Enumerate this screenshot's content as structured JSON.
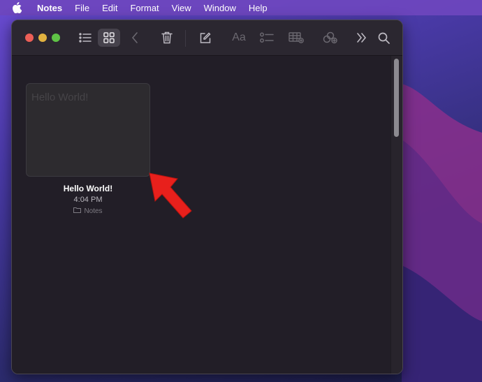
{
  "menubar": {
    "apple_icon": "apple-logo-icon",
    "items": [
      "Notes",
      "File",
      "Edit",
      "Format",
      "View",
      "Window",
      "Help"
    ]
  },
  "toolbar": {
    "icons": [
      "list-view-icon",
      "gallery-view-icon",
      "back-chevron-icon",
      "trash-icon",
      "compose-icon",
      "format-text-icon",
      "checklist-icon",
      "table-icon",
      "share-link-icon",
      "more-chevrons-icon",
      "search-icon"
    ],
    "format_label": "Aa"
  },
  "note": {
    "preview": "Hello World!",
    "title": "Hello World!",
    "time": "4:04 PM",
    "folder": "Notes"
  },
  "colors": {
    "accent_arrow": "#e8201c",
    "window_bg": "#221e27",
    "menubar": "#6e46be"
  }
}
